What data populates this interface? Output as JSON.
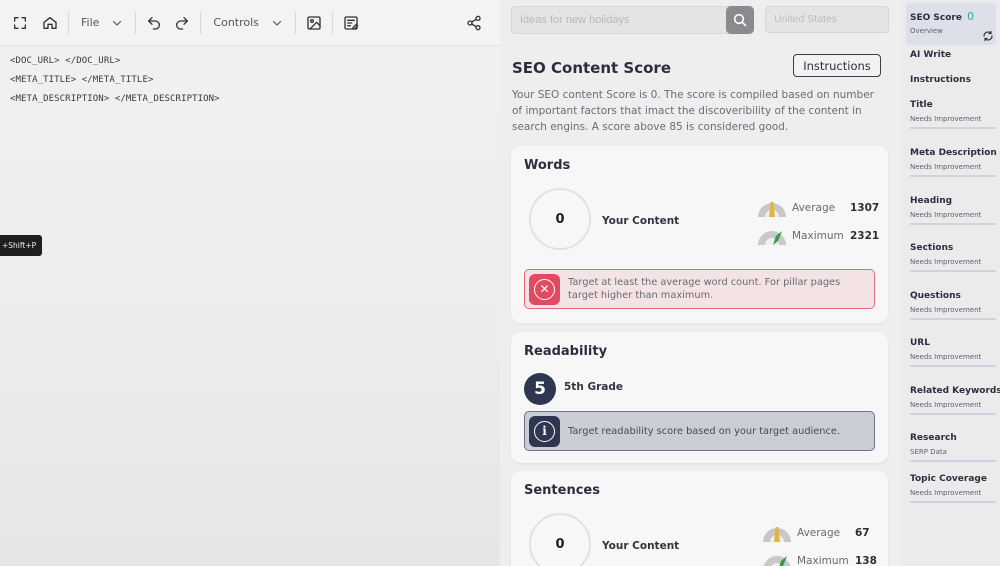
{
  "toolbar": {
    "file_label": "File",
    "controls_label": "Controls"
  },
  "editor": {
    "lines": [
      "<DOC_URL> </DOC_URL>",
      "<META_TITLE> </META_TITLE>",
      "<META_DESCRIPTION> </META_DESCRIPTION>"
    ],
    "shortcut_tooltip": "+Shift+P"
  },
  "search": {
    "placeholder": "Ideas for new holidays",
    "country_placeholder": "United States"
  },
  "panel": {
    "title": "SEO Content Score",
    "instructions_label": "Instructions",
    "description": "Your SEO content Score is 0. The score is compiled based on number of important factors that imact the discoveribility of the content in search engins. A score above 85 is considered good."
  },
  "words": {
    "title": "Words",
    "score": "0",
    "your_content_label": "Your Content",
    "average_label": "Average",
    "average_value": "1307",
    "maximum_label": "Maximum",
    "maximum_value": "2321",
    "alert": "Target at least the average word count. For pillar pages target higher than maximum."
  },
  "readability": {
    "title": "Readability",
    "grade_number": "5",
    "grade_label": "5th Grade",
    "alert": "Target readability score based on your target audience."
  },
  "sentences": {
    "title": "Sentences",
    "score": "0",
    "your_content_label": "Your Content",
    "average_label": "Average",
    "average_value": "67",
    "maximum_label": "Maximum",
    "maximum_value": "138"
  },
  "sidebar": {
    "seo_score": {
      "title": "SEO Score",
      "value": "0",
      "sub": "Overview"
    },
    "items": [
      {
        "title": "AI Write",
        "sub": ""
      },
      {
        "title": "Instructions",
        "sub": ""
      },
      {
        "title": "Title",
        "sub": "Needs Improvement"
      },
      {
        "title": "Meta Description",
        "sub": "Needs Improvement"
      },
      {
        "title": "Heading",
        "sub": "Needs Improvement"
      },
      {
        "title": "Sections",
        "sub": "Needs Improvement"
      },
      {
        "title": "Questions",
        "sub": "Needs Improvement"
      },
      {
        "title": "URL",
        "sub": "Needs Improvement"
      },
      {
        "title": "Related Keywords",
        "sub": "Needs Improvement"
      },
      {
        "title": "Research",
        "sub": "SERP Data"
      },
      {
        "title": "Topic Coverage",
        "sub": "Needs Improvement"
      }
    ]
  },
  "colors": {
    "accent_teal": "#3aa8a0",
    "error_red": "#e04a63",
    "info_navy": "#2e3650",
    "gauge_gold": "#e2b43a",
    "gauge_green": "#2f9a4a"
  }
}
